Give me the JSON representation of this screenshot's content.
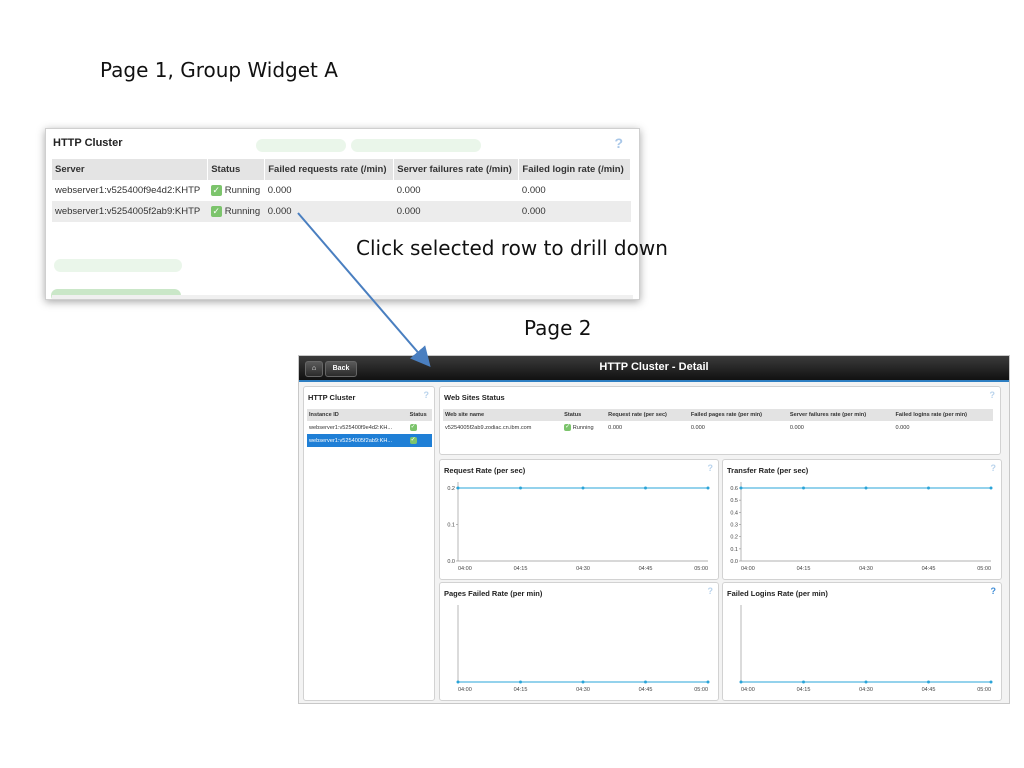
{
  "slide": {
    "title_page1": "Page 1, Group Widget A",
    "callout": "Click selected row to drill down",
    "title_page2": "Page 2"
  },
  "widget_a": {
    "title": "HTTP Cluster",
    "help_icon": "?",
    "columns": [
      "Server",
      "Status",
      "Failed requests rate (/min)",
      "Server failures rate (/min)",
      "Failed login rate (/min)"
    ],
    "rows": [
      {
        "server": "webserver1:v525400f9e4d2:KHTP",
        "status": "Running",
        "failed_requests": "0.000",
        "server_failures": "0.000",
        "failed_login": "0.000"
      },
      {
        "server": "webserver1:v5254005f2ab9:KHTP",
        "status": "Running",
        "failed_requests": "0.000",
        "server_failures": "0.000",
        "failed_login": "0.000"
      }
    ]
  },
  "detail": {
    "title": "HTTP Cluster - Detail",
    "back_label": "Back",
    "home_icon": "home-icon",
    "cluster_panel": {
      "title": "HTTP Cluster",
      "help_icon": "?",
      "columns": [
        "Instance ID",
        "Status"
      ],
      "rows": [
        {
          "instance": "webserver1:v525400f9e4d2:KH...",
          "selected": false
        },
        {
          "instance": "webserver1:v5254005f2ab9:KH...",
          "selected": true
        }
      ]
    },
    "sites_panel": {
      "title": "Web Sites Status",
      "help_icon": "?",
      "columns": [
        "Web site name",
        "Status",
        "Request rate (per sec)",
        "Failed pages rate (per min)",
        "Server failures rate (per min)",
        "Failed logins rate (per min)"
      ],
      "row": {
        "name": "v5254005f2ab9.zodiac.cn.ibm.com",
        "status": "Running",
        "request_rate": "0.000",
        "failed_pages": "0.000",
        "server_failures": "0.000",
        "failed_logins": "0.000"
      }
    },
    "charts_help_icon": "?",
    "colors": {
      "series": "#2aa4d8",
      "selected_row": "#1f7fd6",
      "accent": "#2e7fc2",
      "running": "#7cc46c"
    }
  },
  "chart_data": [
    {
      "type": "line",
      "title": "Request Rate (per sec)",
      "x": [
        "04:00",
        "04:15",
        "04:30",
        "04:45",
        "05:00"
      ],
      "series": [
        {
          "values": [
            0.2,
            0.2,
            0.2,
            0.2,
            0.2
          ]
        }
      ],
      "y_ticks": [
        "0.0",
        "0.1",
        "0.2"
      ],
      "ylim": [
        0,
        0.2
      ]
    },
    {
      "type": "line",
      "title": "Transfer Rate (per sec)",
      "x": [
        "04:00",
        "04:15",
        "04:30",
        "04:45",
        "05:00"
      ],
      "series": [
        {
          "values": [
            0.6,
            0.6,
            0.6,
            0.6,
            0.6
          ]
        }
      ],
      "y_ticks": [
        "0.0",
        "0.1",
        "0.2",
        "0.3",
        "0.4",
        "0.5",
        "0.6"
      ],
      "ylim": [
        0,
        0.6
      ]
    },
    {
      "type": "line",
      "title": "Pages Failed Rate (per min)",
      "x": [
        "04:00",
        "04:15",
        "04:30",
        "04:45",
        "05:00"
      ],
      "series": [
        {
          "values": [
            0,
            0,
            0,
            0,
            0
          ]
        }
      ],
      "y_ticks": [],
      "ylim": [
        0,
        1
      ]
    },
    {
      "type": "line",
      "title": "Failed Logins Rate (per min)",
      "x": [
        "04:00",
        "04:15",
        "04:30",
        "04:45",
        "05:00"
      ],
      "series": [
        {
          "values": [
            0,
            0,
            0,
            0,
            0
          ]
        }
      ],
      "y_ticks": [],
      "ylim": [
        0,
        1
      ]
    }
  ]
}
